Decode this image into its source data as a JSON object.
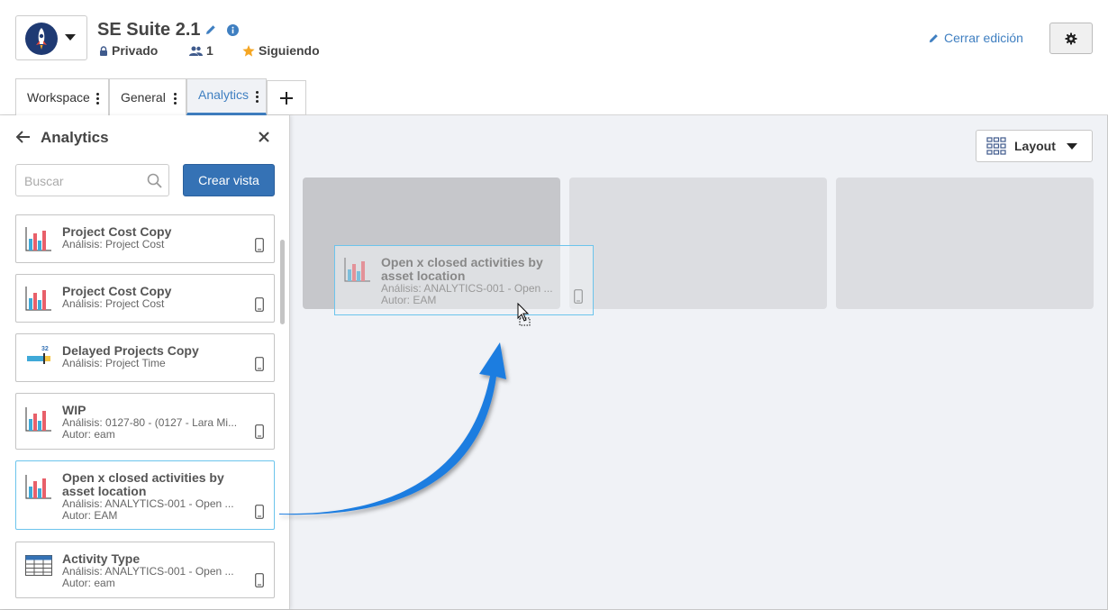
{
  "header": {
    "title": "SE Suite 2.1",
    "privacy": "Privado",
    "members": "1",
    "follow": "Siguiendo",
    "close_edit": "Cerrar edición"
  },
  "tabs": [
    {
      "label": "Workspace"
    },
    {
      "label": "General"
    },
    {
      "label": "Analytics"
    }
  ],
  "sidebar": {
    "title": "Analytics",
    "search_placeholder": "Buscar",
    "create_label": "Crear vista",
    "items": [
      {
        "title": "Project Cost Copy",
        "analysis": "Análisis: Project Cost",
        "icon": "bar-chart-icon"
      },
      {
        "title": "Project Cost Copy",
        "analysis": "Análisis: Project Cost",
        "icon": "bar-chart-icon"
      },
      {
        "title": "Delayed Projects Copy",
        "analysis": "Análisis: Project Time",
        "icon": "gantt-icon"
      },
      {
        "title": "WIP",
        "analysis": "Análisis: 0127-80 - (0127 - Lara Mi...",
        "author": "Autor: eam",
        "icon": "bar-chart-icon"
      },
      {
        "title": "Open x closed activities by asset location",
        "analysis": "Análisis: ANALYTICS-001 - Open ...",
        "author": "Autor: EAM",
        "icon": "bar-chart-icon"
      },
      {
        "title": "Activity Type",
        "analysis": "Análisis: ANALYTICS-001 - Open ...",
        "author": "Autor: eam",
        "icon": "table-icon"
      }
    ]
  },
  "canvas": {
    "layout_label": "Layout",
    "drag_ghost": {
      "title": "Open x closed activities by asset location",
      "analysis": "Análisis: ANALYTICS-001 - Open ...",
      "author": "Autor: EAM"
    }
  },
  "colors": {
    "accent": "#3f7fc1",
    "primary_button": "#3572b5",
    "arrow": "#1e7de0",
    "bar_red": "#e8606a",
    "bar_blue": "#3fa9d8"
  }
}
